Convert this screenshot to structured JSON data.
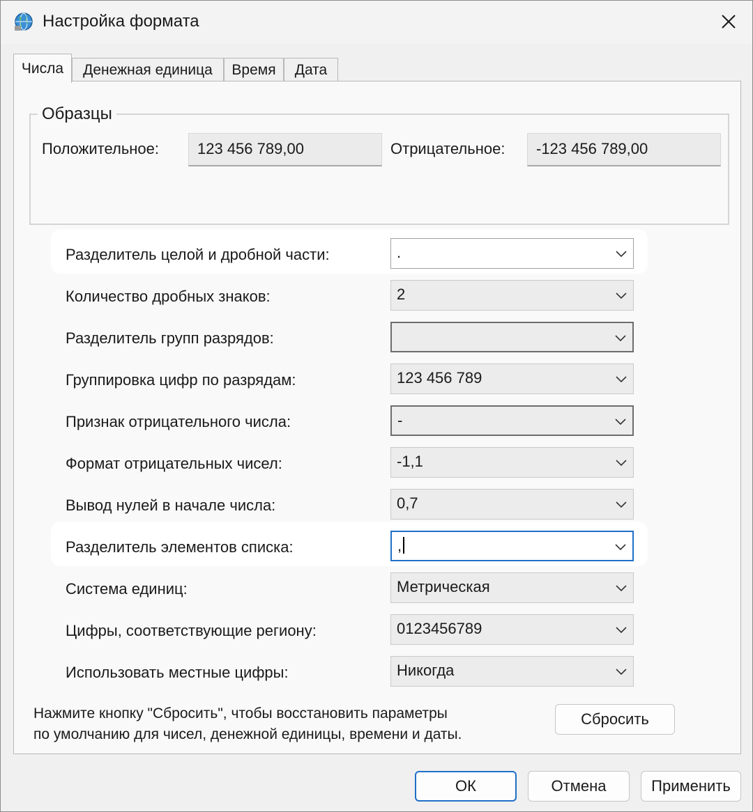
{
  "window": {
    "title": "Настройка формата"
  },
  "tabs": [
    {
      "label": "Числа",
      "active": true
    },
    {
      "label": "Денежная единица"
    },
    {
      "label": "Время"
    },
    {
      "label": "Дата"
    }
  ],
  "samples": {
    "title": "Образцы",
    "positive_label": "Положительное:",
    "positive_value": "123 456 789,00",
    "negative_label": "Отрицательное:",
    "negative_value": "-123 456 789,00"
  },
  "settings": [
    {
      "label": "Разделитель целой и дробной части:",
      "value": "."
    },
    {
      "label": "Количество дробных знаков:",
      "value": "2"
    },
    {
      "label": "Разделитель групп разрядов:",
      "value": ""
    },
    {
      "label": "Группировка цифр по разрядам:",
      "value": "123 456 789"
    },
    {
      "label": "Признак отрицательного числа:",
      "value": "-"
    },
    {
      "label": "Формат отрицательных чисел:",
      "value": "-1,1"
    },
    {
      "label": "Вывод нулей в начале числа:",
      "value": "0,7"
    },
    {
      "label": "Разделитель элементов списка:",
      "value": ","
    },
    {
      "label": "Система единиц:",
      "value": "Метрическая"
    },
    {
      "label": "Цифры, соответствующие региону:",
      "value": "0123456789"
    },
    {
      "label": "Использовать местные цифры:",
      "value": "Никогда"
    }
  ],
  "reset": {
    "text_line1": "Нажмите кнопку \"Сбросить\", чтобы восстановить параметры",
    "text_line2": "по умолчанию для чисел, денежной единицы, времени и даты.",
    "button": "Сбросить"
  },
  "footer": {
    "ok": "ОК",
    "cancel": "Отмена",
    "apply": "Применить"
  },
  "colors": {
    "accent": "#1f6fc8",
    "highlight": "#ffffff",
    "background": "#f0f0f0"
  },
  "icons": {
    "app": "globe-settings-icon",
    "close": "close-icon",
    "dropdown": "chevron-down-icon"
  }
}
